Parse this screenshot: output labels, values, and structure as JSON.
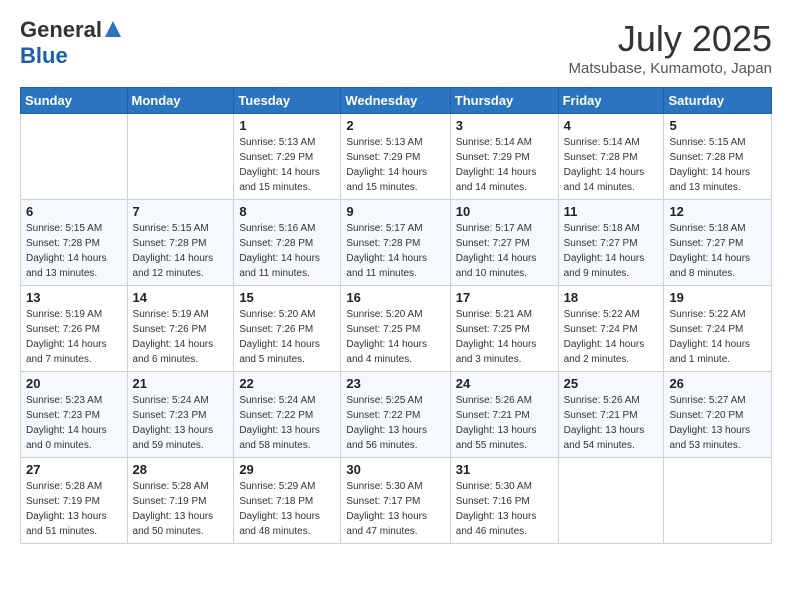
{
  "logo": {
    "general": "General",
    "blue": "Blue"
  },
  "title": "July 2025",
  "location": "Matsubase, Kumamoto, Japan",
  "days_of_week": [
    "Sunday",
    "Monday",
    "Tuesday",
    "Wednesday",
    "Thursday",
    "Friday",
    "Saturday"
  ],
  "weeks": [
    [
      {
        "day": "",
        "sunrise": "",
        "sunset": "",
        "daylight": ""
      },
      {
        "day": "",
        "sunrise": "",
        "sunset": "",
        "daylight": ""
      },
      {
        "day": "1",
        "sunrise": "Sunrise: 5:13 AM",
        "sunset": "Sunset: 7:29 PM",
        "daylight": "Daylight: 14 hours and 15 minutes."
      },
      {
        "day": "2",
        "sunrise": "Sunrise: 5:13 AM",
        "sunset": "Sunset: 7:29 PM",
        "daylight": "Daylight: 14 hours and 15 minutes."
      },
      {
        "day": "3",
        "sunrise": "Sunrise: 5:14 AM",
        "sunset": "Sunset: 7:29 PM",
        "daylight": "Daylight: 14 hours and 14 minutes."
      },
      {
        "day": "4",
        "sunrise": "Sunrise: 5:14 AM",
        "sunset": "Sunset: 7:28 PM",
        "daylight": "Daylight: 14 hours and 14 minutes."
      },
      {
        "day": "5",
        "sunrise": "Sunrise: 5:15 AM",
        "sunset": "Sunset: 7:28 PM",
        "daylight": "Daylight: 14 hours and 13 minutes."
      }
    ],
    [
      {
        "day": "6",
        "sunrise": "Sunrise: 5:15 AM",
        "sunset": "Sunset: 7:28 PM",
        "daylight": "Daylight: 14 hours and 13 minutes."
      },
      {
        "day": "7",
        "sunrise": "Sunrise: 5:15 AM",
        "sunset": "Sunset: 7:28 PM",
        "daylight": "Daylight: 14 hours and 12 minutes."
      },
      {
        "day": "8",
        "sunrise": "Sunrise: 5:16 AM",
        "sunset": "Sunset: 7:28 PM",
        "daylight": "Daylight: 14 hours and 11 minutes."
      },
      {
        "day": "9",
        "sunrise": "Sunrise: 5:17 AM",
        "sunset": "Sunset: 7:28 PM",
        "daylight": "Daylight: 14 hours and 11 minutes."
      },
      {
        "day": "10",
        "sunrise": "Sunrise: 5:17 AM",
        "sunset": "Sunset: 7:27 PM",
        "daylight": "Daylight: 14 hours and 10 minutes."
      },
      {
        "day": "11",
        "sunrise": "Sunrise: 5:18 AM",
        "sunset": "Sunset: 7:27 PM",
        "daylight": "Daylight: 14 hours and 9 minutes."
      },
      {
        "day": "12",
        "sunrise": "Sunrise: 5:18 AM",
        "sunset": "Sunset: 7:27 PM",
        "daylight": "Daylight: 14 hours and 8 minutes."
      }
    ],
    [
      {
        "day": "13",
        "sunrise": "Sunrise: 5:19 AM",
        "sunset": "Sunset: 7:26 PM",
        "daylight": "Daylight: 14 hours and 7 minutes."
      },
      {
        "day": "14",
        "sunrise": "Sunrise: 5:19 AM",
        "sunset": "Sunset: 7:26 PM",
        "daylight": "Daylight: 14 hours and 6 minutes."
      },
      {
        "day": "15",
        "sunrise": "Sunrise: 5:20 AM",
        "sunset": "Sunset: 7:26 PM",
        "daylight": "Daylight: 14 hours and 5 minutes."
      },
      {
        "day": "16",
        "sunrise": "Sunrise: 5:20 AM",
        "sunset": "Sunset: 7:25 PM",
        "daylight": "Daylight: 14 hours and 4 minutes."
      },
      {
        "day": "17",
        "sunrise": "Sunrise: 5:21 AM",
        "sunset": "Sunset: 7:25 PM",
        "daylight": "Daylight: 14 hours and 3 minutes."
      },
      {
        "day": "18",
        "sunrise": "Sunrise: 5:22 AM",
        "sunset": "Sunset: 7:24 PM",
        "daylight": "Daylight: 14 hours and 2 minutes."
      },
      {
        "day": "19",
        "sunrise": "Sunrise: 5:22 AM",
        "sunset": "Sunset: 7:24 PM",
        "daylight": "Daylight: 14 hours and 1 minute."
      }
    ],
    [
      {
        "day": "20",
        "sunrise": "Sunrise: 5:23 AM",
        "sunset": "Sunset: 7:23 PM",
        "daylight": "Daylight: 14 hours and 0 minutes."
      },
      {
        "day": "21",
        "sunrise": "Sunrise: 5:24 AM",
        "sunset": "Sunset: 7:23 PM",
        "daylight": "Daylight: 13 hours and 59 minutes."
      },
      {
        "day": "22",
        "sunrise": "Sunrise: 5:24 AM",
        "sunset": "Sunset: 7:22 PM",
        "daylight": "Daylight: 13 hours and 58 minutes."
      },
      {
        "day": "23",
        "sunrise": "Sunrise: 5:25 AM",
        "sunset": "Sunset: 7:22 PM",
        "daylight": "Daylight: 13 hours and 56 minutes."
      },
      {
        "day": "24",
        "sunrise": "Sunrise: 5:26 AM",
        "sunset": "Sunset: 7:21 PM",
        "daylight": "Daylight: 13 hours and 55 minutes."
      },
      {
        "day": "25",
        "sunrise": "Sunrise: 5:26 AM",
        "sunset": "Sunset: 7:21 PM",
        "daylight": "Daylight: 13 hours and 54 minutes."
      },
      {
        "day": "26",
        "sunrise": "Sunrise: 5:27 AM",
        "sunset": "Sunset: 7:20 PM",
        "daylight": "Daylight: 13 hours and 53 minutes."
      }
    ],
    [
      {
        "day": "27",
        "sunrise": "Sunrise: 5:28 AM",
        "sunset": "Sunset: 7:19 PM",
        "daylight": "Daylight: 13 hours and 51 minutes."
      },
      {
        "day": "28",
        "sunrise": "Sunrise: 5:28 AM",
        "sunset": "Sunset: 7:19 PM",
        "daylight": "Daylight: 13 hours and 50 minutes."
      },
      {
        "day": "29",
        "sunrise": "Sunrise: 5:29 AM",
        "sunset": "Sunset: 7:18 PM",
        "daylight": "Daylight: 13 hours and 48 minutes."
      },
      {
        "day": "30",
        "sunrise": "Sunrise: 5:30 AM",
        "sunset": "Sunset: 7:17 PM",
        "daylight": "Daylight: 13 hours and 47 minutes."
      },
      {
        "day": "31",
        "sunrise": "Sunrise: 5:30 AM",
        "sunset": "Sunset: 7:16 PM",
        "daylight": "Daylight: 13 hours and 46 minutes."
      },
      {
        "day": "",
        "sunrise": "",
        "sunset": "",
        "daylight": ""
      },
      {
        "day": "",
        "sunrise": "",
        "sunset": "",
        "daylight": ""
      }
    ]
  ]
}
